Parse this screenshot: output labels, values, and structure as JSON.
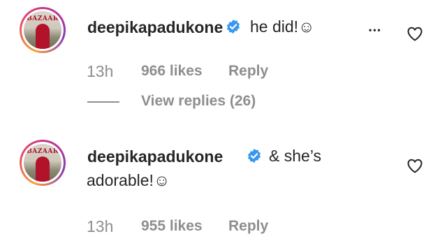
{
  "comments": [
    {
      "username": "deepikapadukone",
      "avatar_text": "BAZAAR",
      "text": "he did!☺",
      "time": "13h",
      "likes": "966 likes",
      "reply_label": "Reply",
      "more_label": "•••",
      "view_replies": "View replies (26)"
    },
    {
      "username": "deepikapadukone",
      "avatar_text": "BAZAAR",
      "text_line1": "& she’s",
      "text_line2": "adorable!☺",
      "time": "13h",
      "likes": "955 likes",
      "reply_label": "Reply"
    }
  ],
  "colors": {
    "verified": "#3897f0",
    "meta_text": "#8e8e8e",
    "primary_text": "#262626"
  }
}
